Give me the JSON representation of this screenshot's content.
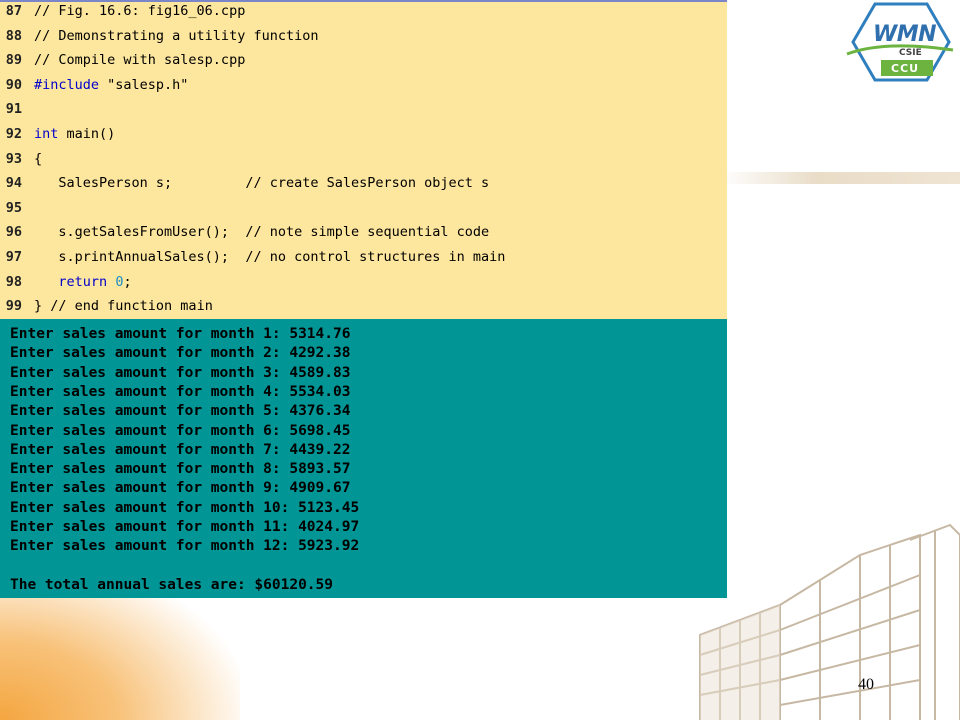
{
  "logo": {
    "primary": "WMN",
    "secondary": "CSIE",
    "tertiary": "CCU"
  },
  "code_lines": [
    {
      "no": "87",
      "segments": [
        {
          "t": "// Fig. 16.6: fig16_06.cpp",
          "c": "cmt"
        }
      ]
    },
    {
      "no": "88",
      "segments": [
        {
          "t": "// Demonstrating a utility function",
          "c": "cmt"
        }
      ]
    },
    {
      "no": "89",
      "segments": [
        {
          "t": "// Compile with salesp.cpp",
          "c": "cmt"
        }
      ]
    },
    {
      "no": "90",
      "segments": [
        {
          "t": "#include ",
          "c": "kw"
        },
        {
          "t": "\"salesp.h\"",
          "c": ""
        }
      ]
    },
    {
      "no": "91",
      "segments": []
    },
    {
      "no": "92",
      "segments": [
        {
          "t": "int",
          "c": "kw"
        },
        {
          "t": " main()",
          "c": ""
        }
      ]
    },
    {
      "no": "93",
      "segments": [
        {
          "t": "{",
          "c": ""
        }
      ]
    },
    {
      "no": "94",
      "segments": [
        {
          "t": "   SalesPerson s;         ",
          "c": ""
        },
        {
          "t": "// create SalesPerson object s",
          "c": "cmt"
        }
      ]
    },
    {
      "no": "95",
      "segments": []
    },
    {
      "no": "96",
      "segments": [
        {
          "t": "   s.getSalesFromUser();  ",
          "c": ""
        },
        {
          "t": "// note simple sequential code",
          "c": "cmt"
        }
      ]
    },
    {
      "no": "97",
      "segments": [
        {
          "t": "   s.printAnnualSales();  ",
          "c": ""
        },
        {
          "t": "// no control structures in main",
          "c": "cmt"
        }
      ]
    },
    {
      "no": "98",
      "segments": [
        {
          "t": "   ",
          "c": ""
        },
        {
          "t": "return",
          "c": "kw"
        },
        {
          "t": " ",
          "c": ""
        },
        {
          "t": "0",
          "c": "num"
        },
        {
          "t": ";",
          "c": ""
        }
      ]
    },
    {
      "no": "99",
      "segments": [
        {
          "t": "} ",
          "c": ""
        },
        {
          "t": "// end function main",
          "c": "cmt"
        }
      ]
    }
  ],
  "output_lines": [
    "Enter sales amount for month 1: 5314.76",
    "Enter sales amount for month 2: 4292.38",
    "Enter sales amount for month 3: 4589.83",
    "Enter sales amount for month 4: 5534.03",
    "Enter sales amount for month 5: 4376.34",
    "Enter sales amount for month 6: 5698.45",
    "Enter sales amount for month 7: 4439.22",
    "Enter sales amount for month 8: 5893.57",
    "Enter sales amount for month 9: 4909.67",
    "Enter sales amount for month 10: 5123.45",
    "Enter sales amount for month 11: 4024.97",
    "Enter sales amount for month 12: 5923.92",
    "",
    "The total annual sales are: $60120.59"
  ],
  "page_number": "40",
  "colors": {
    "code_bg": "#fde69d",
    "output_bg": "#019595",
    "keyword": "#0000cc",
    "number": "#1a8ec8"
  }
}
